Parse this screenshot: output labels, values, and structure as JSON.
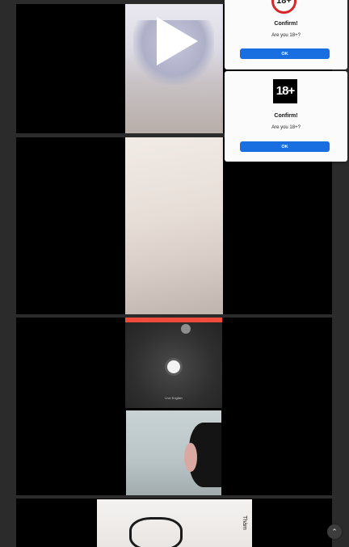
{
  "popups": [
    {
      "badge": "18+",
      "title": "Confirm!",
      "question": "Are you 18+?",
      "ok_label": "OK"
    },
    {
      "badge": "18+",
      "title": "Confirm!",
      "question": "Are you 18+?",
      "ok_label": "OK"
    }
  ],
  "media": {
    "card3_caption": "Live English",
    "card4_watermark": "Thàm"
  },
  "icons": {
    "play": "play-icon",
    "scroll_top": "chevron-up-icon"
  },
  "scroll_top_glyph": "⌃",
  "colors": {
    "page_bg": "#2b2b2b",
    "badge_ring": "#d62828",
    "ok_button": "#1a6fe0"
  }
}
